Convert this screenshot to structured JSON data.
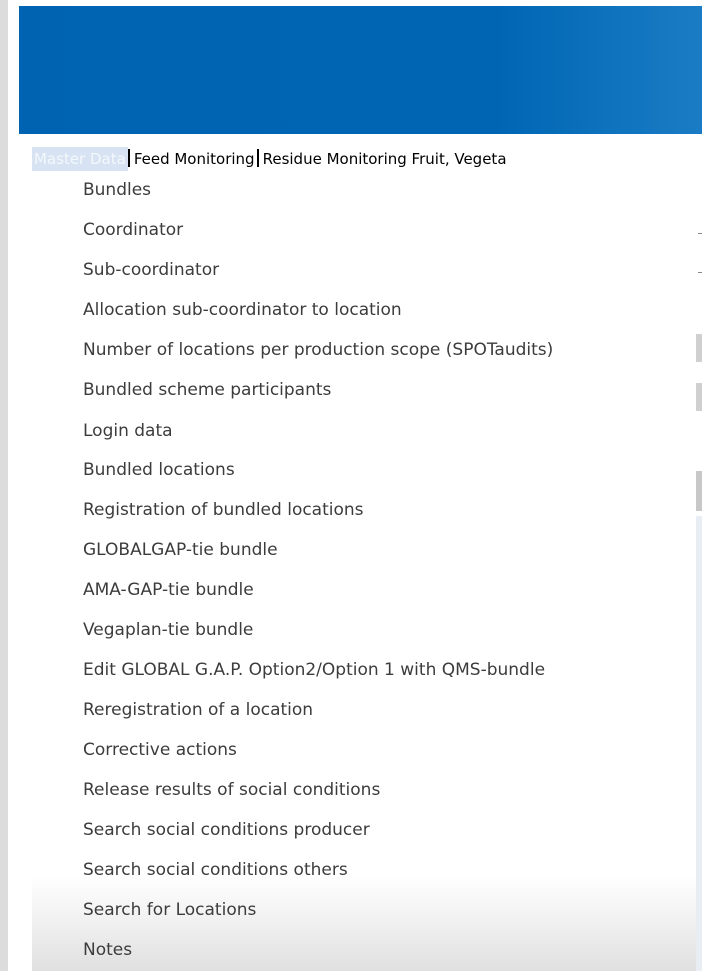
{
  "nav": {
    "items": [
      "Master Data",
      "Feed Monitoring",
      "Residue Monitoring Fruit, Vegeta"
    ]
  },
  "menu": {
    "items": [
      "Bundles",
      "Coordinator",
      "Sub-coordinator",
      "Allocation sub-coordinator to location",
      "Number of locations per production scope (SPOTaudits)",
      "Bundled scheme participants",
      "Login data",
      "Bundled locations",
      "Registration of bundled locations",
      "GLOBALGAP-tie bundle",
      "AMA-GAP-tie bundle",
      "Vegaplan-tie bundle",
      "Edit GLOBAL G.A.P. Option2/Option 1 with QMS-bundle",
      "Reregistration of a location",
      "Corrective actions",
      "Release results of social conditions",
      "Search social conditions producer",
      "Search social conditions others",
      "Search for Locations",
      "Notes"
    ]
  },
  "colors": {
    "header": "#0066b4",
    "active_nav": "#d7e3f2",
    "menu_text": "#3c3c3c"
  }
}
